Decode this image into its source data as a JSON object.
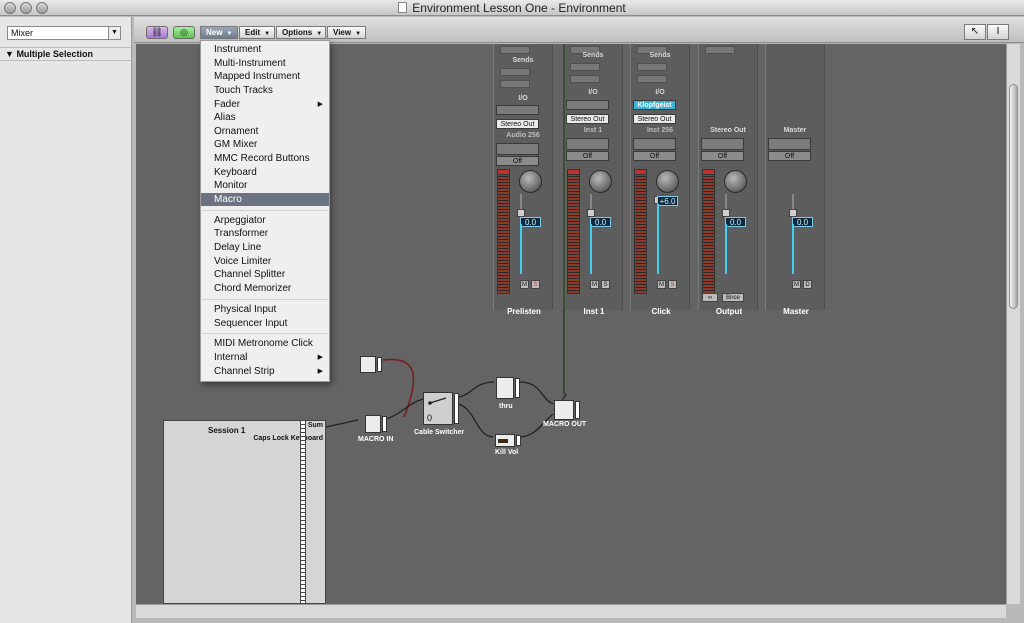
{
  "window": {
    "title": "Environment Lesson One - Environment"
  },
  "inspector": {
    "layer": "Mixer",
    "selection_header": "Multiple Selection"
  },
  "toolbar": {
    "menus": {
      "new": "New",
      "edit": "Edit",
      "options": "Options",
      "view": "View"
    },
    "icons": [
      "link-icon",
      "midi-thru-icon",
      "pointer-tool-icon",
      "text-tool-icon"
    ]
  },
  "menu": {
    "items": [
      {
        "label": "Instrument"
      },
      {
        "label": "Multi-Instrument"
      },
      {
        "label": "Mapped Instrument"
      },
      {
        "label": "Touch Tracks"
      },
      {
        "label": "Fader",
        "submenu": true
      },
      {
        "label": "Alias"
      },
      {
        "label": "Ornament"
      },
      {
        "label": "GM Mixer"
      },
      {
        "label": "MMC Record Buttons"
      },
      {
        "label": "Keyboard"
      },
      {
        "label": "Monitor"
      },
      {
        "label": "Macro",
        "highlighted": true
      },
      {
        "label": "Arpeggiator"
      },
      {
        "label": "Transformer"
      },
      {
        "label": "Delay Line"
      },
      {
        "label": "Voice Limiter"
      },
      {
        "label": "Channel Splitter"
      },
      {
        "label": "Chord Memorizer"
      },
      {
        "label": "Physical Input"
      },
      {
        "label": "Sequencer Input"
      },
      {
        "label": "MIDI Metronome Click"
      },
      {
        "label": "Internal",
        "submenu": true
      },
      {
        "label": "Channel Strip",
        "submenu": true
      }
    ]
  },
  "mixer": {
    "labels": {
      "sends": "Sends",
      "io": "I/O",
      "off": "Off",
      "stereo_out": "Stereo Out",
      "mute": "M",
      "solo": "S",
      "bounce": "Bnce",
      "dim": "D"
    },
    "strips": [
      {
        "name": "Prelisten",
        "track": "Audio 256",
        "volume": "0.0"
      },
      {
        "name": "Inst 1",
        "track": "Inst 1",
        "volume": "0.0"
      },
      {
        "name": "Click",
        "track": "Inst 256",
        "volume": "+6.0",
        "instrument": "Klopfgeist"
      },
      {
        "name": "Output",
        "track": "Stereo Out",
        "volume": "0.0"
      },
      {
        "name": "Master",
        "track": "Master",
        "volume": "0.0"
      }
    ]
  },
  "objects": {
    "macro_in": "MACRO IN",
    "cable_switcher": "Cable Switcher",
    "cable_switcher_value": "0",
    "thru": "thru",
    "kill_vol": "Kill Vol",
    "macro_out": "MACRO OUT",
    "keyboard": {
      "title": "Session 1",
      "sum": "Sum",
      "name": "Caps Lock Keyboard"
    }
  }
}
